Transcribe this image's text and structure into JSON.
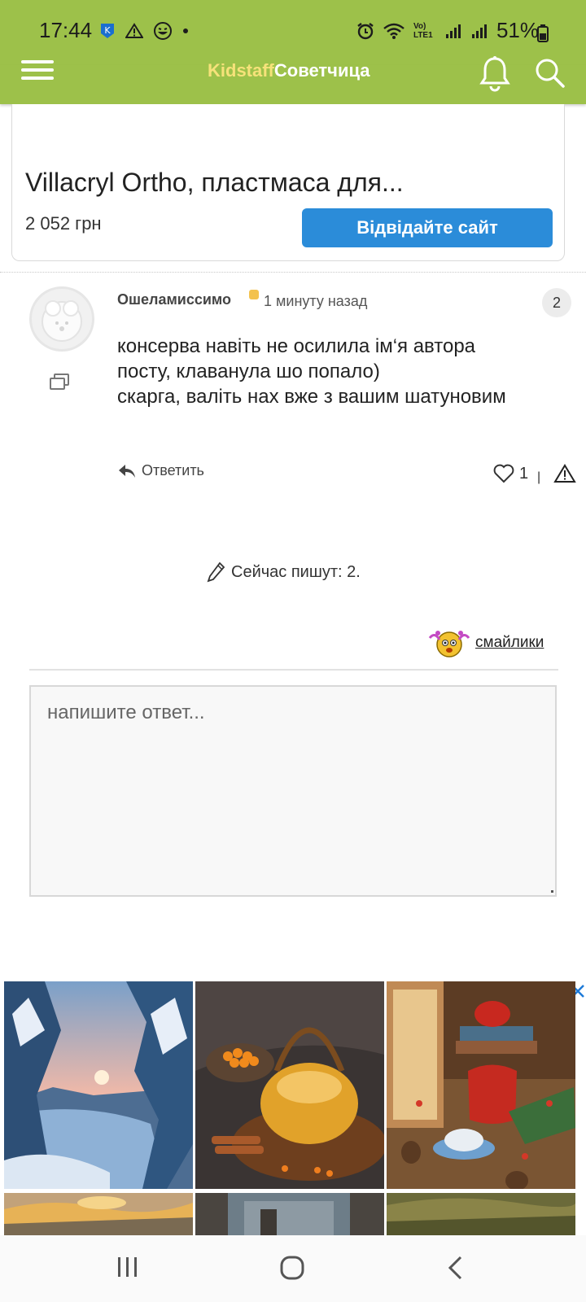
{
  "status_bar": {
    "time": "17:44",
    "battery": "51%",
    "network_label": "Vo) LTE1",
    "accent": "#9dc14a"
  },
  "header": {
    "logo_brand": "Kidstaff",
    "logo_rest": "Советчица"
  },
  "top_ad": {
    "title": "Villacryl Ortho, пластмаса для...",
    "price": "2 052 грн",
    "button": "Відвідайте сайт",
    "button_color": "#2b8cd9"
  },
  "post": {
    "author": "Ошеламиссимо",
    "time": "1 минуту назад",
    "number": "2",
    "text_lines": [
      "консерва навіть не осилила ім‘я автора",
      "посту, клаванула шо попало)",
      "скарга, валіть нах вже з вашим шатуновим"
    ],
    "reply_label": "Ответить",
    "likes": "1",
    "divider": "|"
  },
  "typing": {
    "text": "Сейчас пишут: 2."
  },
  "editor": {
    "smileys_label": " смайлики",
    "placeholder": "напишите ответ..."
  },
  "bottom_ads": {
    "icons": [
      "info-icon",
      "close-icon"
    ],
    "tiles": [
      "winter-river-painting",
      "tea-kettle-painting",
      "holiday-still-life-painting",
      "sunset-painting",
      "village-painting",
      "landscape-painting"
    ]
  }
}
